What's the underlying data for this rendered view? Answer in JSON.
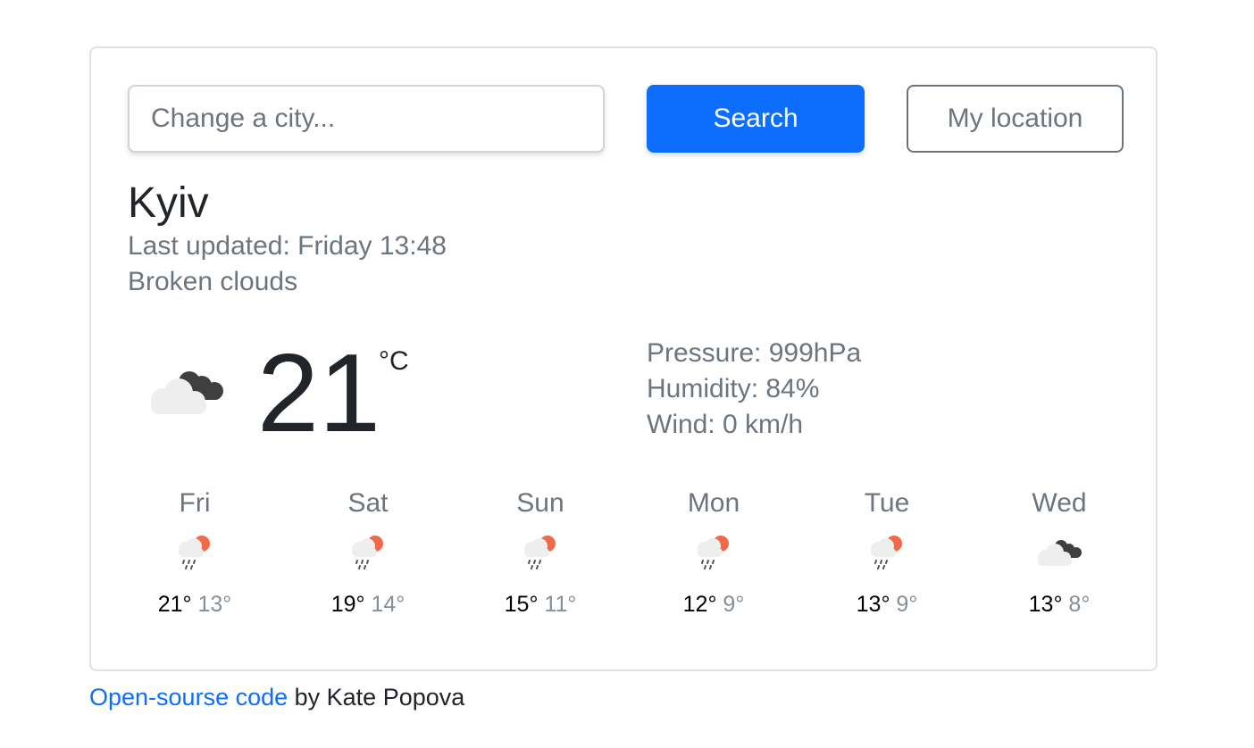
{
  "search": {
    "placeholder": "Change a city...",
    "search_label": "Search",
    "location_label": "My location"
  },
  "current": {
    "city": "Kyiv",
    "last_updated": "Last updated: Friday 13:48",
    "description": "Broken clouds",
    "icon": "broken-clouds-icon",
    "temperature": "21",
    "unit": "°C",
    "pressure": "Pressure: 999hPa",
    "humidity": "Humidity: 84%",
    "wind": "Wind: 0 km/h"
  },
  "forecast": [
    {
      "day": "Fri",
      "max": "21°",
      "min": "13°",
      "icon": "rain-sun-icon"
    },
    {
      "day": "Sat",
      "max": "19°",
      "min": "14°",
      "icon": "rain-sun-icon"
    },
    {
      "day": "Sun",
      "max": "15°",
      "min": "11°",
      "icon": "rain-sun-icon"
    },
    {
      "day": "Mon",
      "max": "12°",
      "min": "9°",
      "icon": "rain-sun-icon"
    },
    {
      "day": "Tue",
      "max": "13°",
      "min": "9°",
      "icon": "rain-sun-icon"
    },
    {
      "day": "Wed",
      "max": "13°",
      "min": "8°",
      "icon": "broken-clouds-icon"
    }
  ],
  "footer": {
    "link_text": "Open-sourse code",
    "author_text": " by Kate Popova"
  },
  "colors": {
    "accent": "#0d6efd",
    "muted_text": "#6c757d",
    "min_temp": "#868e96",
    "sun": "#f06a4a",
    "dark_cloud": "#3f3f3f",
    "light_cloud": "#eeeeee"
  }
}
